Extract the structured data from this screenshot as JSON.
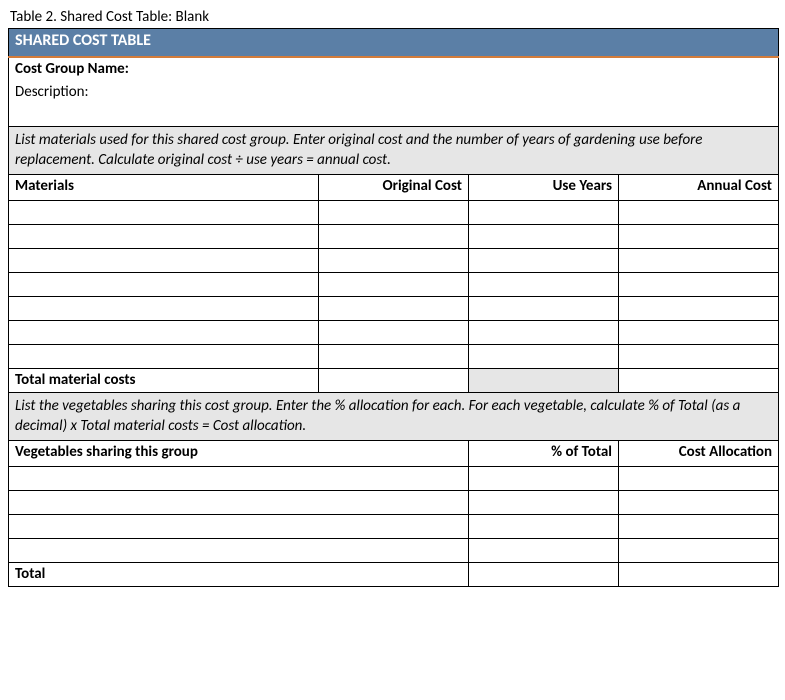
{
  "caption": "Table 2. Shared Cost Table: Blank",
  "header_bar": "SHARED COST TABLE",
  "cost_group_label": "Cost Group Name:",
  "description_label": "Description:",
  "instruction1": "List materials used for this shared cost group. Enter original cost and the number of years of gardening use before replacement. Calculate original cost ÷ use years = annual cost.",
  "materials_header": {
    "col1": "Materials",
    "col2": "Original Cost",
    "col3": "Use Years",
    "col4": "Annual Cost"
  },
  "materials_rows": [
    {
      "name": "",
      "original_cost": "",
      "use_years": "",
      "annual_cost": ""
    },
    {
      "name": "",
      "original_cost": "",
      "use_years": "",
      "annual_cost": ""
    },
    {
      "name": "",
      "original_cost": "",
      "use_years": "",
      "annual_cost": ""
    },
    {
      "name": "",
      "original_cost": "",
      "use_years": "",
      "annual_cost": ""
    },
    {
      "name": "",
      "original_cost": "",
      "use_years": "",
      "annual_cost": ""
    },
    {
      "name": "",
      "original_cost": "",
      "use_years": "",
      "annual_cost": ""
    },
    {
      "name": "",
      "original_cost": "",
      "use_years": "",
      "annual_cost": ""
    }
  ],
  "total_materials_label": "Total material costs",
  "instruction2": "List the vegetables sharing this cost group. Enter the % allocation for each. For each vegetable, calculate % of Total (as a decimal) x Total material costs = Cost allocation.",
  "vegetables_header": {
    "col1": "Vegetables sharing this group",
    "col2": "% of Total",
    "col3": "Cost Allocation"
  },
  "vegetables_rows": [
    {
      "name": "",
      "pct": "",
      "alloc": ""
    },
    {
      "name": "",
      "pct": "",
      "alloc": ""
    },
    {
      "name": "",
      "pct": "",
      "alloc": ""
    },
    {
      "name": "",
      "pct": "",
      "alloc": ""
    }
  ],
  "total_label": "Total"
}
